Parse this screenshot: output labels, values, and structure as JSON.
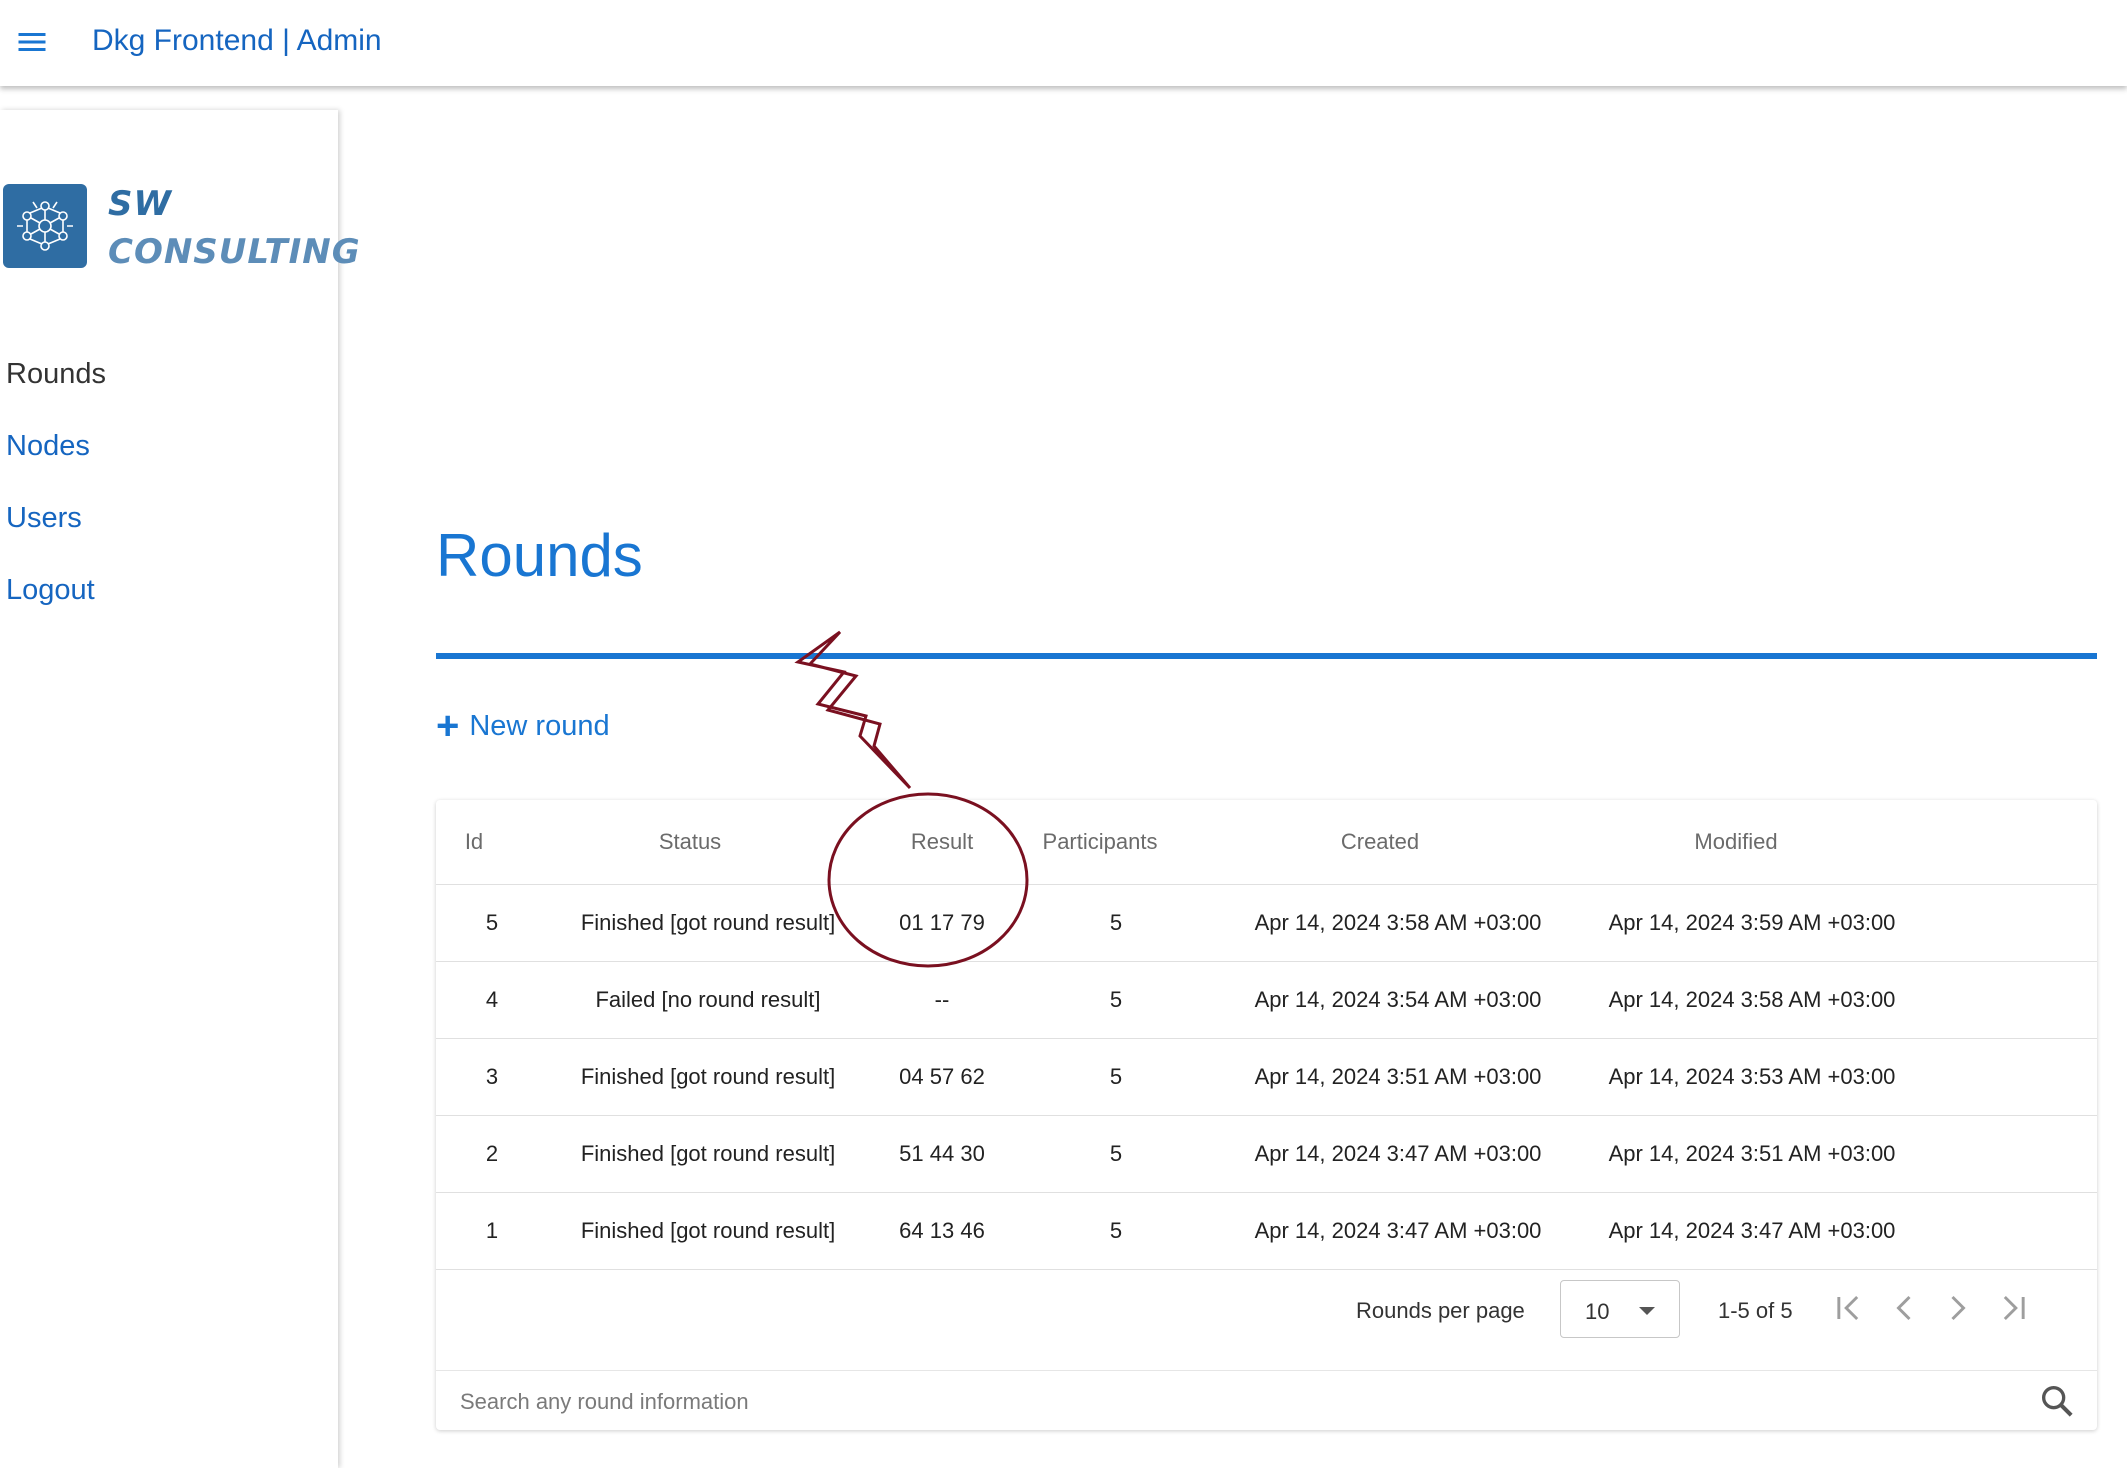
{
  "appbar": {
    "title": "Dkg Frontend | Admin",
    "menu_icon": "menu-icon"
  },
  "sidebar": {
    "logo": {
      "line1": "SW",
      "line2": "CONSULTING"
    },
    "items": [
      {
        "label": "Rounds",
        "active": true
      },
      {
        "label": "Nodes",
        "active": false
      },
      {
        "label": "Users",
        "active": false
      },
      {
        "label": "Logout",
        "active": false
      }
    ]
  },
  "main": {
    "title": "Rounds",
    "new_round_icon": "+",
    "new_round_label": "New round",
    "table": {
      "headers": {
        "id": "Id",
        "status": "Status",
        "result": "Result",
        "participants": "Participants",
        "created": "Created",
        "modified": "Modified"
      },
      "rows": [
        {
          "id": "5",
          "status": "Finished [got round result]",
          "result": "01 17 79",
          "participants": "5",
          "created": "Apr 14, 2024 3:58 AM +03:00",
          "modified": "Apr 14, 2024 3:59 AM +03:00"
        },
        {
          "id": "4",
          "status": "Failed [no round result]",
          "result": "--",
          "participants": "5",
          "created": "Apr 14, 2024 3:54 AM +03:00",
          "modified": "Apr 14, 2024 3:58 AM +03:00"
        },
        {
          "id": "3",
          "status": "Finished [got round result]",
          "result": "04 57 62",
          "participants": "5",
          "created": "Apr 14, 2024 3:51 AM +03:00",
          "modified": "Apr 14, 2024 3:53 AM +03:00"
        },
        {
          "id": "2",
          "status": "Finished [got round result]",
          "result": "51 44 30",
          "participants": "5",
          "created": "Apr 14, 2024 3:47 AM +03:00",
          "modified": "Apr 14, 2024 3:51 AM +03:00"
        },
        {
          "id": "1",
          "status": "Finished [got round result]",
          "result": "64 13 46",
          "participants": "5",
          "created": "Apr 14, 2024 3:47 AM +03:00",
          "modified": "Apr 14, 2024 3:47 AM +03:00"
        }
      ]
    },
    "pagination": {
      "rows_per_page_label": "Rounds per page",
      "rows_per_page_value": "10",
      "range": "1-5 of 5"
    },
    "search": {
      "placeholder": "Search any round information"
    }
  },
  "colors": {
    "brand": "#1976d2",
    "annotation": "#7a1020",
    "logo_bg": "#2f6da3"
  }
}
